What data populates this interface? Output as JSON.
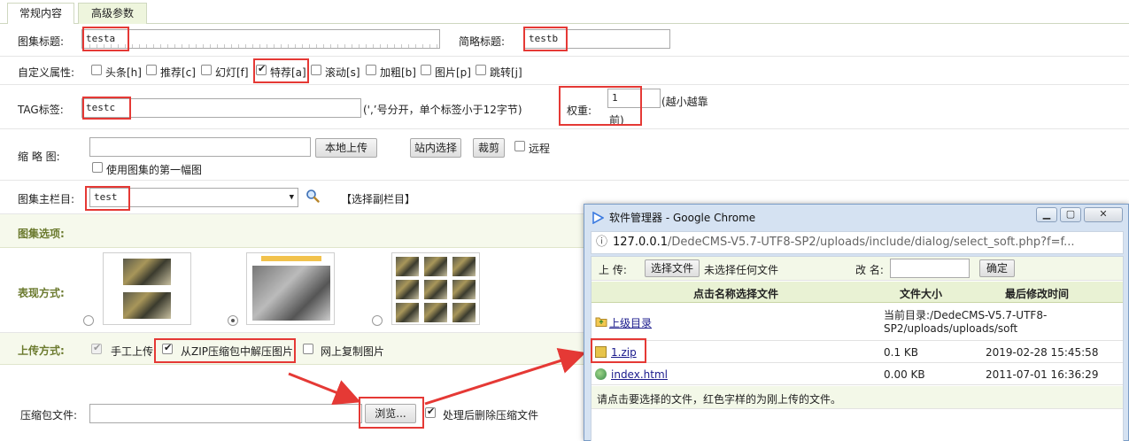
{
  "tabs": [
    "常规内容",
    "高级参数"
  ],
  "form": {
    "title_label": "图集标题:",
    "title_value": "testa",
    "short_title_label": "简略标题:",
    "short_title_value": "testb",
    "attr_label": "自定义属性:",
    "attrs": [
      {
        "label": "头条[h]",
        "checked": false
      },
      {
        "label": "推荐[c]",
        "checked": false
      },
      {
        "label": "幻灯[f]",
        "checked": false
      },
      {
        "label": "特荐[a]",
        "checked": true
      },
      {
        "label": "滚动[s]",
        "checked": false
      },
      {
        "label": "加粗[b]",
        "checked": false
      },
      {
        "label": "图片[p]",
        "checked": false
      },
      {
        "label": "跳转[j]",
        "checked": false
      }
    ],
    "tag_label": "TAG标签:",
    "tag_value": "testc",
    "tag_hint": "(',’号分开，单个标签小于12字节)",
    "weight_label": "权重:",
    "weight_value": "1",
    "weight_hint_a": "(越小越靠",
    "weight_hint_b": "前)",
    "thumb_label": "缩 略 图:",
    "upload_local": "本地上传",
    "site_select": "站内选择",
    "crop": "裁剪",
    "remote": "远程",
    "use_first": "使用图集的第一幅图",
    "column_label": "图集主栏目:",
    "column_value": "test",
    "sub_column": "【选择副栏目】",
    "options_label": "图集选项:",
    "display_label": "表现方式:",
    "display_selected": 1,
    "upload_mode_label": "上传方式:",
    "upload_modes": [
      {
        "label": "手工上传",
        "checked": true,
        "disabled": true
      },
      {
        "label": "从ZIP压缩包中解压图片",
        "checked": true,
        "disabled": false
      },
      {
        "label": "网上复制图片",
        "checked": false,
        "disabled": false
      }
    ],
    "zip_label": "压缩包文件:",
    "browse": "浏览...",
    "delete_after": "处理后删除压缩文件"
  },
  "popup": {
    "title": "软件管理器 - Google Chrome",
    "url_host": "127.0.0.1",
    "url_path": "/DedeCMS-V5.7-UTF8-SP2/uploads/include/dialog/select_soft.php?f=f...",
    "upload_label": "上 传:",
    "choose_file": "选择文件",
    "no_file": "未选择任何文件",
    "rename_label": "改 名:",
    "ok": "确定",
    "headers": [
      "点击名称选择文件",
      "文件大小",
      "最后修改时间"
    ],
    "parent_dir": "上级目录",
    "current_dir_a": "当前目录:/DedeCMS-V5.7-UTF8-",
    "current_dir_b": "SP2/uploads/uploads/soft",
    "files": [
      {
        "name": "1.zip",
        "size": "0.1 KB",
        "time": "2019-02-28 15:45:58"
      },
      {
        "name": "index.html",
        "size": "0.00 KB",
        "time": "2011-07-01 16:36:29"
      }
    ],
    "tip": "请点击要选择的文件，红色字样的为刚上传的文件。"
  },
  "colors": {
    "highlight": "#e53935",
    "green_label": "#6b7a2e",
    "green_bg": "#f6f9ec"
  }
}
